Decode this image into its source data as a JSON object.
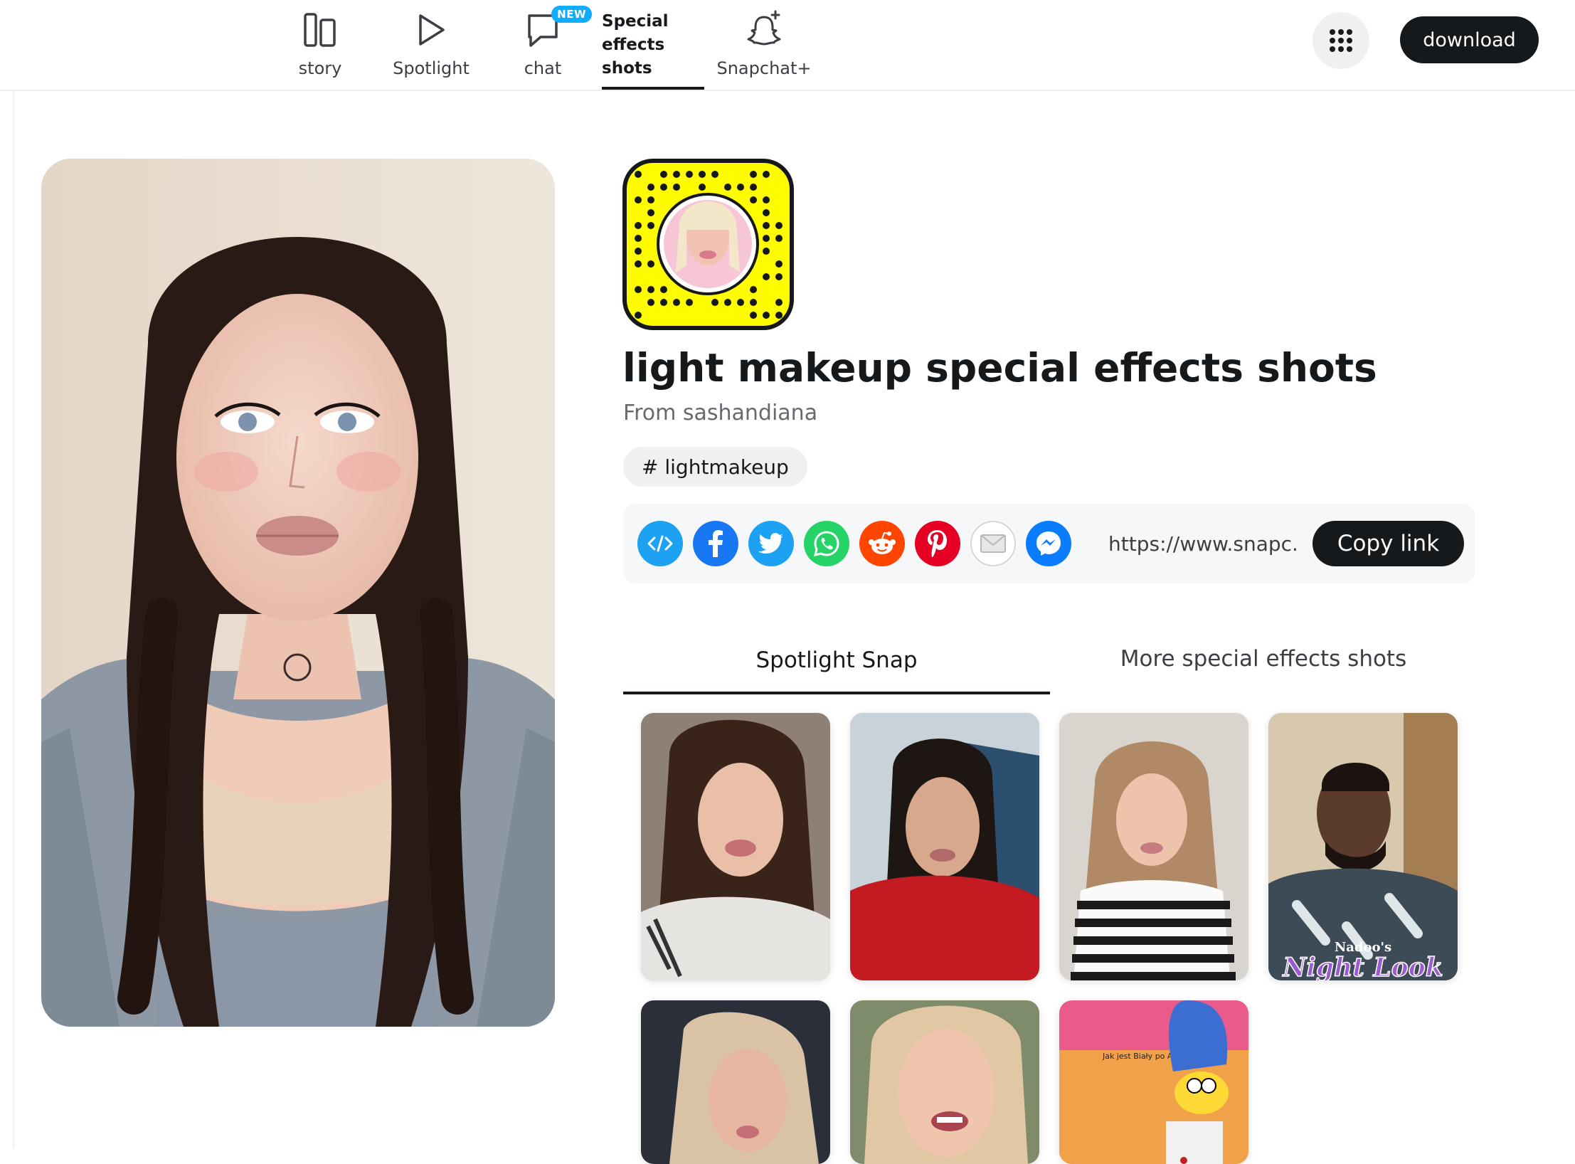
{
  "nav": {
    "items": [
      {
        "label": "story",
        "icon": "story-icon"
      },
      {
        "label": "Spotlight",
        "icon": "spotlight-play-icon"
      },
      {
        "label": "chat",
        "icon": "chat-bubble-icon",
        "badge": "NEW"
      },
      {
        "label": "Snapchat+",
        "icon": "snapchat-plus-ghost-icon"
      }
    ],
    "active": {
      "line1": "Special",
      "line2": "effects",
      "line3": "shots"
    },
    "download_label": "download"
  },
  "lens": {
    "title": "light makeup special effects shots",
    "author": "From sashandiana",
    "tag": "# lightmakeup"
  },
  "share": {
    "icons": [
      "embed-icon",
      "facebook-icon",
      "twitter-icon",
      "whatsapp-icon",
      "reddit-icon",
      "pinterest-icon",
      "email-icon",
      "messenger-icon"
    ],
    "url": "https://www.snapc...",
    "copy_label": "Copy link"
  },
  "tabs": {
    "active": "Spotlight Snap",
    "other": "More special effects shots"
  },
  "thumbnails": {
    "overlay_nadoo": "Nadoo's",
    "overlay_night": "Night Look",
    "overlay_simpsons": "Jak jest Biały po Angielsku"
  },
  "colors": {
    "brand_yellow": "#FFFC00",
    "text_dark": "#16191C",
    "badge_blue": "#0FADFF"
  }
}
